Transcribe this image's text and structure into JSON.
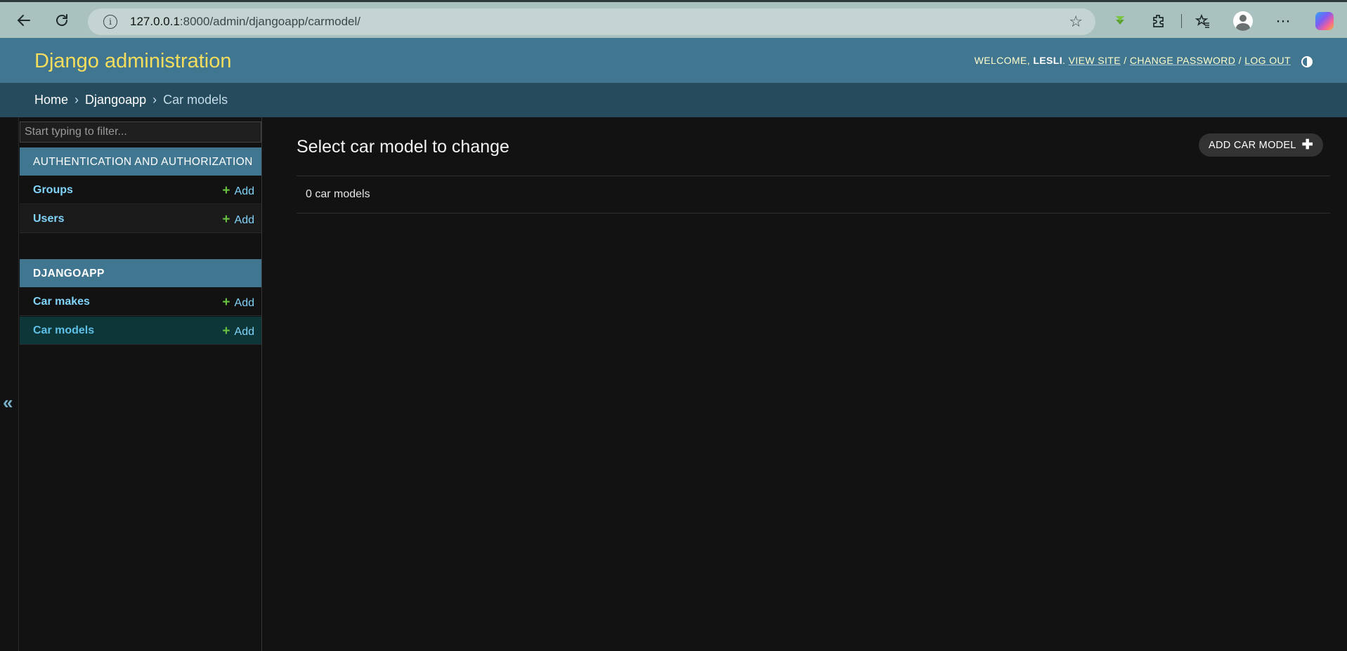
{
  "browser": {
    "url_host": "127.0.0.1",
    "url_rest": ":8000/admin/djangoapp/carmodel/"
  },
  "header": {
    "brand": "Django administration",
    "welcome": "WELCOME,",
    "username": "LESLI",
    "view_site": "VIEW SITE",
    "change_password": "CHANGE PASSWORD",
    "log_out": "LOG OUT",
    "sep": "/"
  },
  "breadcrumbs": {
    "home": "Home",
    "app": "Djangoapp",
    "current": "Car models",
    "sep": "›"
  },
  "sidebar": {
    "filter_placeholder": "Start typing to filter...",
    "toggle": "«",
    "modules": [
      {
        "caption": "AUTHENTICATION AND AUTHORIZATION",
        "models": [
          {
            "name": "Groups",
            "add": "Add"
          },
          {
            "name": "Users",
            "add": "Add"
          }
        ]
      },
      {
        "caption": "DJANGOAPP",
        "models": [
          {
            "name": "Car makes",
            "add": "Add"
          },
          {
            "name": "Car models",
            "add": "Add"
          }
        ]
      }
    ]
  },
  "main": {
    "title": "Select car model to change",
    "add_button": "ADD CAR MODEL",
    "result_count": "0 car models"
  },
  "colors": {
    "header_bg": "#417690",
    "brand": "#f5dd5d",
    "breadcrumbs_bg": "#264b5d",
    "link": "#81d4fa",
    "add_plus": "#6ac340",
    "selected_row": "#0d3638"
  }
}
